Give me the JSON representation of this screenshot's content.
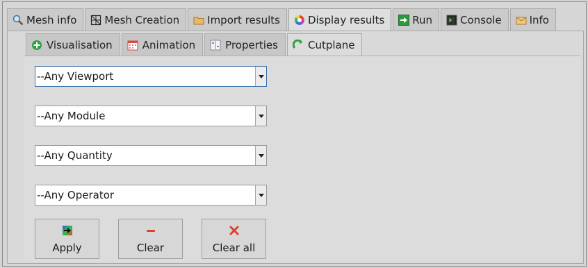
{
  "tabs": [
    {
      "label": "Mesh info",
      "icon": "magnifier-icon"
    },
    {
      "label": "Mesh Creation",
      "icon": "mesh-grid-icon"
    },
    {
      "label": "Import results",
      "icon": "folder-icon"
    },
    {
      "label": "Display results",
      "icon": "color-wheel-icon",
      "active": true
    },
    {
      "label": "Run",
      "icon": "run-arrow-icon"
    },
    {
      "label": "Console",
      "icon": "console-icon"
    },
    {
      "label": "Info",
      "icon": "info-envelope-icon"
    }
  ],
  "subtabs": [
    {
      "label": "Visualisation",
      "icon": "green-plus-icon"
    },
    {
      "label": "Animation",
      "icon": "calendar-icon"
    },
    {
      "label": "Properties",
      "icon": "properties-icon"
    },
    {
      "label": "Cutplane",
      "icon": "cutplane-icon",
      "active": true
    }
  ],
  "filters": {
    "viewport": "--Any Viewport",
    "module": "--Any Module",
    "quantity": "--Any Quantity",
    "operator": "--Any Operator"
  },
  "buttons": {
    "apply": "Apply",
    "clear": "Clear",
    "clear_all": "Clear all"
  },
  "colors": {
    "accent": "#3a6ea5",
    "clear_icon": "#e0402a",
    "clear_all_icon": "#e0402a"
  }
}
